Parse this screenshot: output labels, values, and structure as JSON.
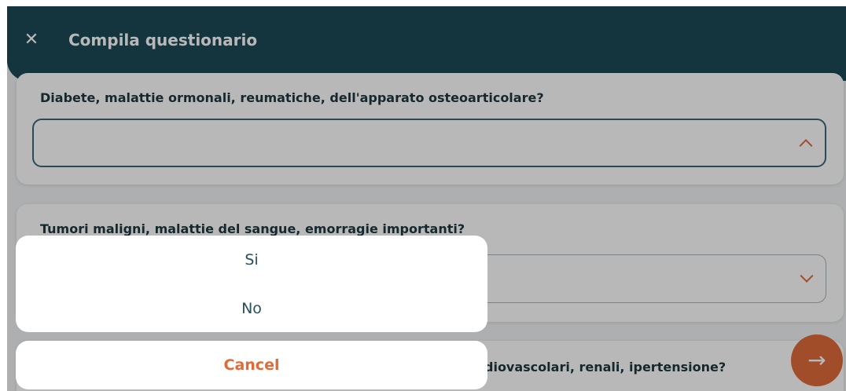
{
  "header": {
    "close_icon": "close-icon",
    "title": "Compila questionario"
  },
  "questions": [
    {
      "text": "Diabete, malattie ormonali, reumatiche, dell'apparato osteoarticolare?",
      "value": "",
      "chevron": "chevron-up-icon"
    },
    {
      "text": "Tumori maligni, malattie del sangue, emorragie importanti?",
      "value": "",
      "chevron": "chevron-down-icon"
    },
    {
      "text": "diovascolari, renali, ipertensione?"
    }
  ],
  "next_button": {
    "icon": "arrow-right-icon"
  },
  "action_sheet": {
    "options": [
      "Si",
      "No"
    ],
    "cancel_label": "Cancel"
  },
  "colors": {
    "header": "#1e4a56",
    "accent": "#e06b3a",
    "text": "#1e3840"
  }
}
